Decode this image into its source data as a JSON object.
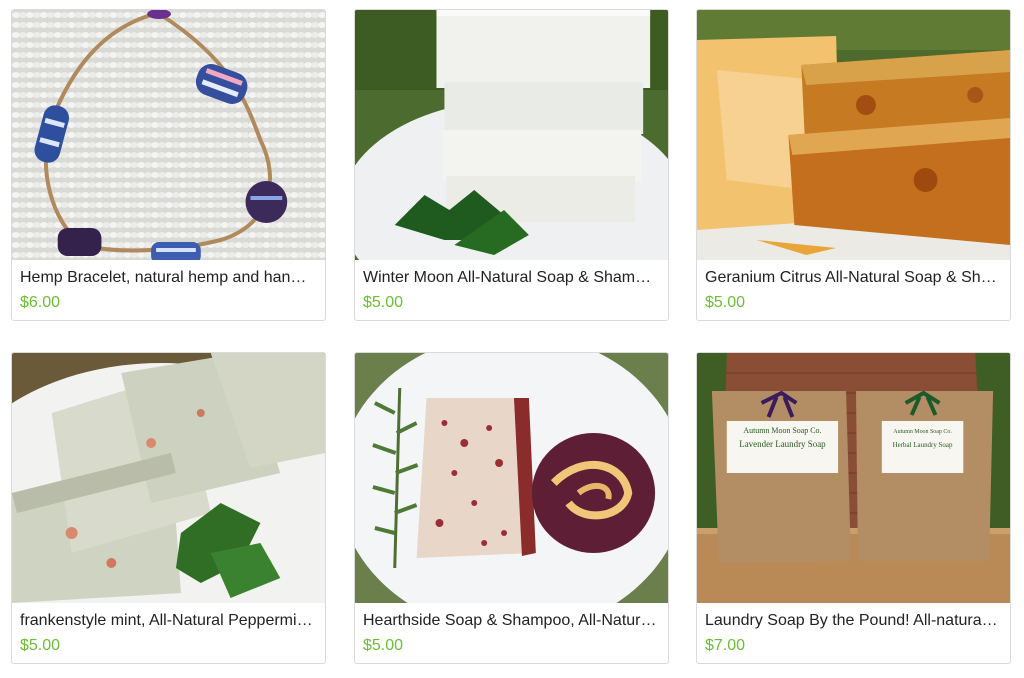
{
  "listings": [
    {
      "title": "Hemp Bracelet, natural hemp and handmade beads",
      "price": "$6.00",
      "image": "hemp-bracelet-photo"
    },
    {
      "title": "Winter Moon All-Natural Soap & Shampoo Bar",
      "price": "$5.00",
      "image": "white-soap-stack-photo"
    },
    {
      "title": "Geranium Citrus All-Natural Soap & Shampoo Bar",
      "price": "$5.00",
      "image": "orange-soap-bars-photo"
    },
    {
      "title": "frankenstyle mint, All-Natural Peppermint Soap",
      "price": "$5.00",
      "image": "mint-soap-bars-photo"
    },
    {
      "title": "Hearthside Soap & Shampoo, All-Natural Bar",
      "price": "$5.00",
      "image": "red-speckled-soap-photo"
    },
    {
      "title": "Laundry Soap By the Pound! All-natural laundry soap",
      "price": "$7.00",
      "image": "laundry-soap-bags-photo"
    }
  ],
  "bag_labels": {
    "left": {
      "brand": "Autumn Moon Soap Co.",
      "product": "Lavender Laundry Soap"
    },
    "right": {
      "brand": "Autumn Moon Soap Co.",
      "product": "Herbal Laundry Soap"
    }
  }
}
